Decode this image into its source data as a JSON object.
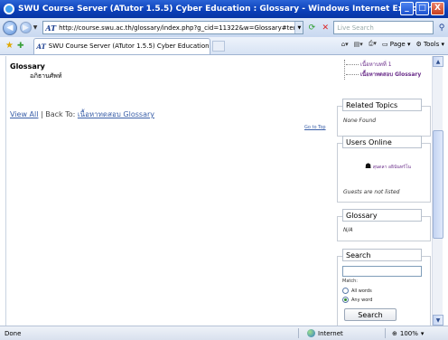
{
  "window": {
    "title": "SWU Course Server (ATutor 1.5.5) Cyber Education : Glossary - Windows Internet Explorer",
    "buttons": [
      "_",
      "□",
      "X"
    ]
  },
  "addressbar": {
    "url": "http://course.swu.ac.th/glossary/index.php?g_cid=11322&w=Glossary#term",
    "search_placeholder": "Live Search"
  },
  "tab": {
    "label": "SWU Course Server (ATutor 1.5.5) Cyber Education :..."
  },
  "commandbar": {
    "page_label": "Page",
    "tools_label": "Tools"
  },
  "content": {
    "heading": "Glossary",
    "subheading": "อภิธานศัพท์",
    "view_all": "View All",
    "separator": " | Back To: ",
    "back_link": "เนื้อหาทดสอบ Glossary",
    "go_to_top": "Go to Top"
  },
  "side": {
    "nav_items": [
      "เนื้อหาบทที่ 1",
      "เนื้อหาทดสอบ Glossary"
    ],
    "related_topics": {
      "title": "Related Topics",
      "text": "None Found"
    },
    "users_online": {
      "title": "Users Online",
      "user": "สุนดลา อธินันทร์โน",
      "guests": "Guests are not listed"
    },
    "glossary": {
      "title": "Glossary",
      "text": "N/A"
    },
    "search": {
      "title": "Search",
      "match_label": "Match:",
      "opt_all": "All words",
      "opt_any": "Any word",
      "button": "Search"
    }
  },
  "statusbar": {
    "left": "Done",
    "zone": "Internet",
    "zoom": "100%"
  }
}
